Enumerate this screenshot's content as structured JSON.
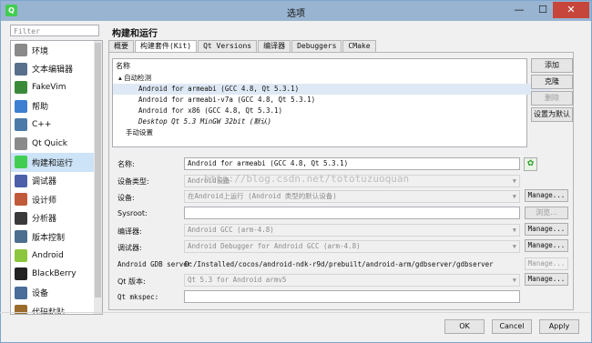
{
  "window": {
    "title": "选项",
    "minimize": "—",
    "maximize": "☐",
    "close": "✕"
  },
  "sidebar": {
    "filter_placeholder": "Filter",
    "items": [
      {
        "label": "环境",
        "color": "#8a8a8a"
      },
      {
        "label": "文本编辑器",
        "color": "#5a6f8c"
      },
      {
        "label": "FakeVim",
        "color": "#3a8a3a"
      },
      {
        "label": "帮助",
        "color": "#3d7fd1"
      },
      {
        "label": "C++",
        "color": "#4b7aa8"
      },
      {
        "label": "Qt Quick",
        "color": "#8a8a8a"
      },
      {
        "label": "构建和运行",
        "color": "#41cd52"
      },
      {
        "label": "调试器",
        "color": "#4c5fa8"
      },
      {
        "label": "设计师",
        "color": "#c05a3a"
      },
      {
        "label": "分析器",
        "color": "#3a3a3a"
      },
      {
        "label": "版本控制",
        "color": "#4d6e8f"
      },
      {
        "label": "Android",
        "color": "#8cc63f"
      },
      {
        "label": "BlackBerry",
        "color": "#222222"
      },
      {
        "label": "设备",
        "color": "#4a6d9a"
      },
      {
        "label": "代码粘贴",
        "color": "#9a6b2b"
      }
    ]
  },
  "heading": "构建和运行",
  "tabs": [
    "概要",
    "构建套件(Kit)",
    "Qt Versions",
    "编译器",
    "Debuggers",
    "CMake"
  ],
  "tree": {
    "header": "名称",
    "groups": [
      {
        "label": "自动检测",
        "children": [
          "Android for armeabi (GCC 4.8, Qt 5.3.1)",
          "Android for armeabi-v7a (GCC 4.8, Qt 5.3.1)",
          "Android for x86 (GCC 4.8, Qt 5.3.1)",
          "Desktop Qt 5.3 MinGW 32bit (默认)"
        ]
      },
      {
        "label": "手动设置",
        "children": []
      }
    ]
  },
  "side_buttons": {
    "add": "添加",
    "clone": "克隆",
    "remove": "删除",
    "set_default": "设置为默认"
  },
  "form": {
    "name_label": "名称:",
    "name_value": "Android for armeabi (GCC 4.8, Qt 5.3.1)",
    "device_type_label": "设备类型:",
    "device_type_value": "Android设备",
    "device_label": "设备:",
    "device_value": "在Android上运行 (Android 类型的默认设备)",
    "sysroot_label": "Sysroot:",
    "sysroot_value": "",
    "browse": "浏览...",
    "compiler_label": "编译器:",
    "compiler_value": "Android GCC (arm-4.8)",
    "debugger_label": "调试器:",
    "debugger_value": "Android Debugger for Android GCC (arm-4.8)",
    "gdb_label": "Android GDB server",
    "gdb_value": "D:/Installed/cocos/android-ndk-r9d/prebuilt/android-arm/gdbserver/gdbserver",
    "qt_version_label": "Qt 版本:",
    "qt_version_value": "Qt 5.3 for Android armv5",
    "mkspec_label": "Qt mkspec:",
    "mkspec_value": "",
    "manage": "Manage..."
  },
  "watermark": "http://blog.csdn.net/tototuzuoquan",
  "footer": {
    "ok": "OK",
    "cancel": "Cancel",
    "apply": "Apply"
  }
}
